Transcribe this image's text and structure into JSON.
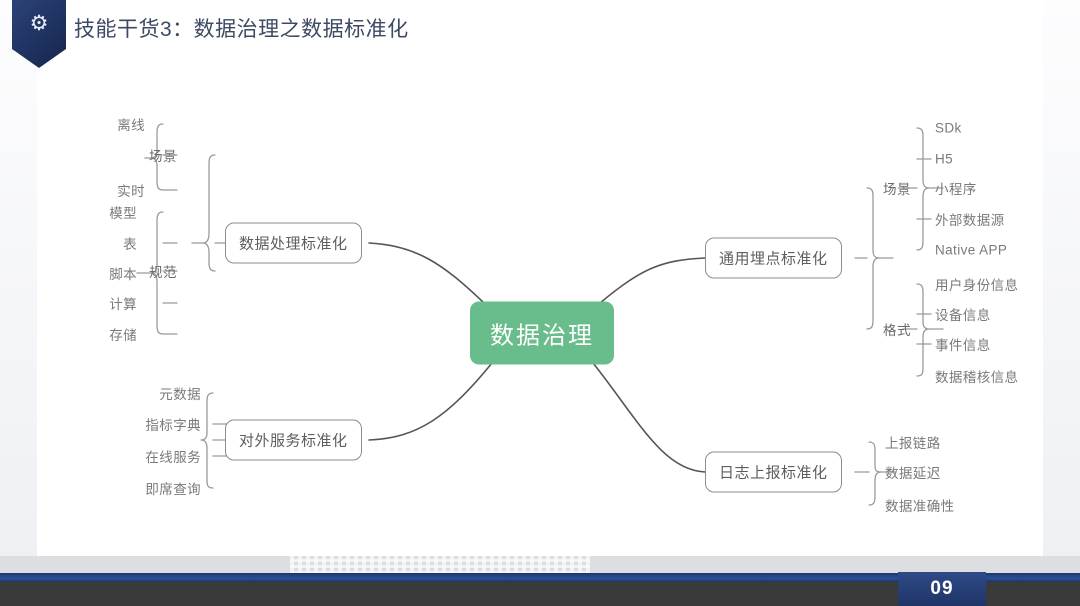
{
  "header": {
    "badge_icon": "gear-person-icon",
    "title": "技能干货3：数据治理之数据标准化"
  },
  "footer": {
    "page_number": "09"
  },
  "colors": {
    "center_node": "#69bd8c",
    "branch_border": "#8d8d8d",
    "link": "#555555",
    "title_text": "#3d4a63",
    "badge_blue": "#1f3360",
    "page_num_blue": "#2e4a86"
  },
  "mindmap": {
    "center": {
      "label": "数据治理"
    },
    "branches": [
      {
        "label": "数据处理标准化",
        "side": "left",
        "groups": [
          {
            "label": "场景",
            "leaves": [
              "离线",
              "实时"
            ]
          },
          {
            "label": "规范",
            "leaves": [
              "模型",
              "表",
              "脚本",
              "计算",
              "存储"
            ]
          }
        ]
      },
      {
        "label": "对外服务标准化",
        "side": "left",
        "groups": [
          {
            "label": "",
            "leaves": [
              "元数据",
              "指标字典",
              "在线服务",
              "即席查询"
            ]
          }
        ]
      },
      {
        "label": "通用埋点标准化",
        "side": "right",
        "groups": [
          {
            "label": "场景",
            "leaves": [
              "SDk",
              "H5",
              "小程序",
              "外部数据源",
              "Native APP"
            ]
          },
          {
            "label": "格式",
            "leaves": [
              "用户身份信息",
              "设备信息",
              "事件信息",
              "数据稽核信息"
            ]
          }
        ]
      },
      {
        "label": "日志上报标准化",
        "side": "right",
        "groups": [
          {
            "label": "",
            "leaves": [
              "上报链路",
              "数据延迟",
              "数据准确性"
            ]
          }
        ]
      }
    ]
  }
}
